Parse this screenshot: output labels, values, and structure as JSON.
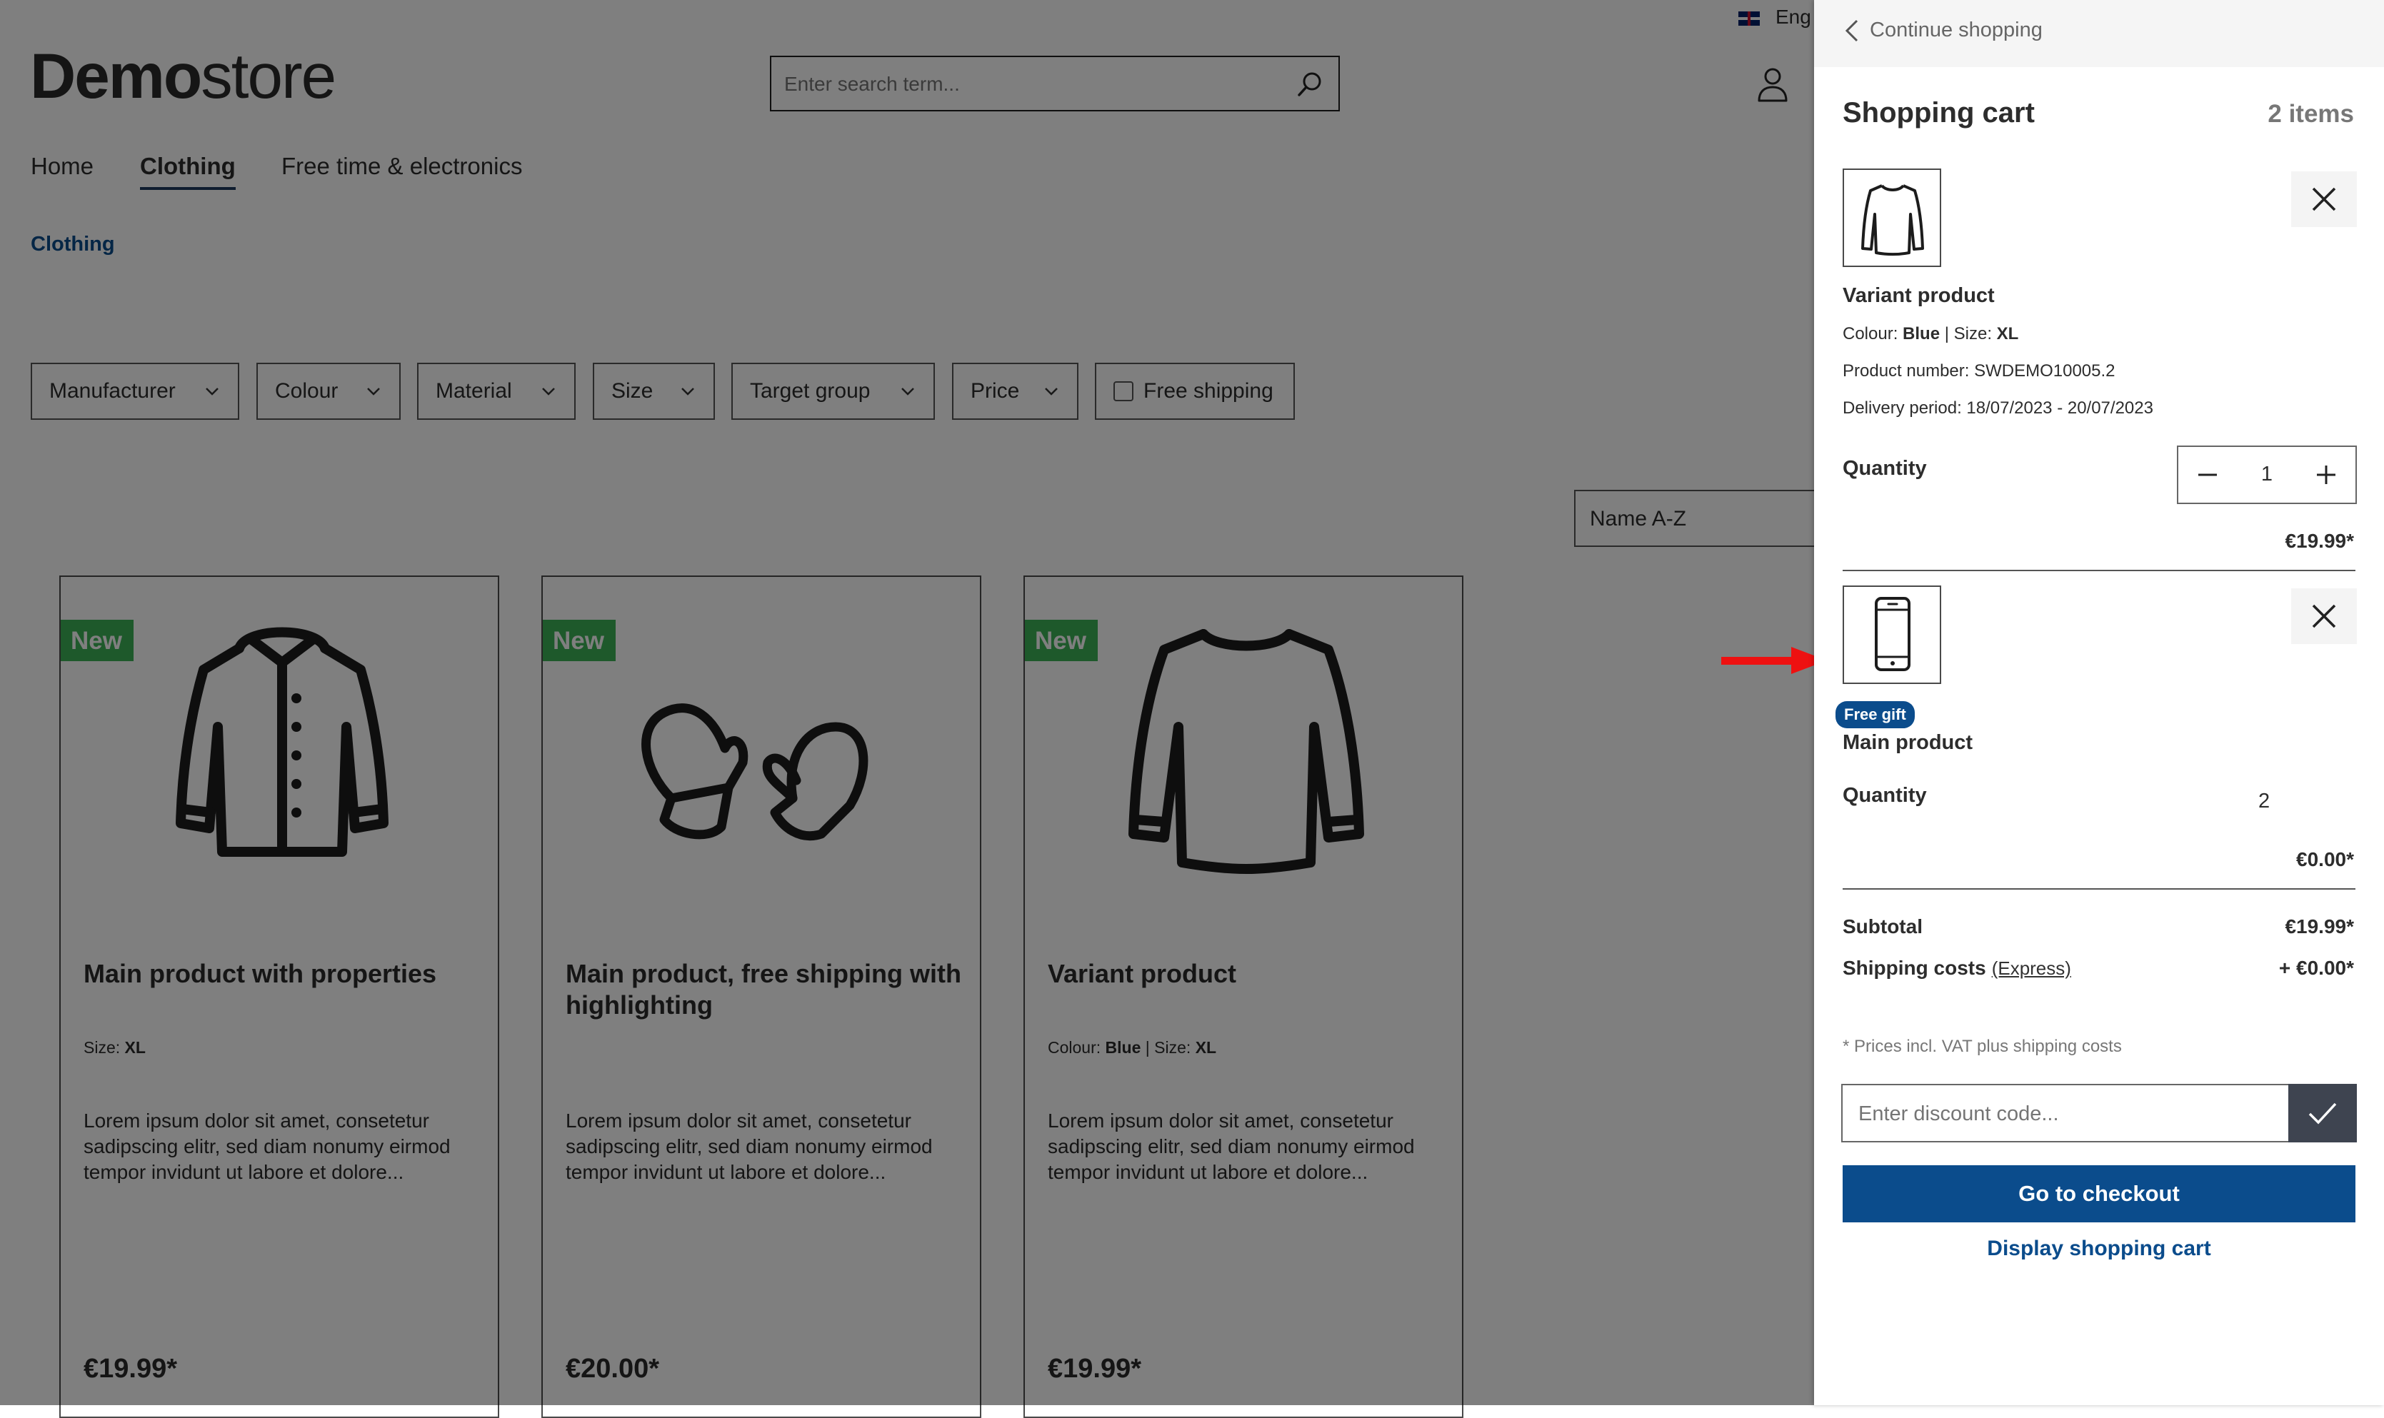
{
  "header": {
    "logo_bold": "Demo",
    "logo_light": "store",
    "search_placeholder": "Enter search term...",
    "language": "Eng"
  },
  "nav": {
    "items": [
      {
        "label": "Home"
      },
      {
        "label": "Clothing",
        "active": true
      },
      {
        "label": "Free time & electronics"
      }
    ]
  },
  "breadcrumb": "Clothing",
  "filters": {
    "manufacturer": "Manufacturer",
    "colour": "Colour",
    "material": "Material",
    "size": "Size",
    "target_group": "Target group",
    "price": "Price",
    "free_shipping": "Free shipping"
  },
  "sort": "Name A-Z",
  "products": [
    {
      "badge": "New",
      "name": "Main product with properties",
      "props": {
        "size_label": "Size:",
        "size": "XL"
      },
      "description": "Lorem ipsum dolor sit amet, consetetur sadipscing elitr, sed diam nonumy eirmod tempor invidunt ut labore et dolore...",
      "price": "€19.99*"
    },
    {
      "badge": "New",
      "name": "Main product, free shipping with highlighting",
      "description": "Lorem ipsum dolor sit amet, consetetur sadipscing elitr, sed diam nonumy eirmod tempor invidunt ut labore et dolore...",
      "price": "€20.00*"
    },
    {
      "badge": "New",
      "name": "Variant product",
      "props": {
        "colour_label": "Colour:",
        "colour": "Blue",
        "size_label": "Size:",
        "size": "XL"
      },
      "description": "Lorem ipsum dolor sit amet, consetetur sadipscing elitr, sed diam nonumy eirmod tempor invidunt ut labore et dolore...",
      "price": "€19.99*"
    }
  ],
  "cart": {
    "continue": "Continue shopping",
    "title": "Shopping cart",
    "count": "2 items",
    "items": [
      {
        "name": "Variant product",
        "colour_label": "Colour:",
        "colour": "Blue",
        "size_label": "Size:",
        "size": "XL",
        "product_number": "Product number: SWDEMO10005.2",
        "delivery": "Delivery period: 18/07/2023 - 20/07/2023",
        "quantity_label": "Quantity",
        "quantity": "1",
        "price": "€19.99*"
      },
      {
        "badge": "Free gift",
        "name": "Main product",
        "quantity_label": "Quantity",
        "quantity": "2",
        "price": "€0.00*"
      }
    ],
    "subtotal_label": "Subtotal",
    "subtotal": "€19.99*",
    "shipping_label": "Shipping costs",
    "shipping_method": "(Express)",
    "shipping": "+ €0.00*",
    "vat_note": "* Prices incl. VAT plus shipping costs",
    "discount_placeholder": "Enter discount code...",
    "checkout": "Go to checkout",
    "display_cart": "Display shopping cart"
  },
  "colors": {
    "primary": "#0b4c8c",
    "new_badge": "#3cb257",
    "annotation_arrow": "#ee1111",
    "overlay": "rgba(0,0,0,0.5)"
  }
}
